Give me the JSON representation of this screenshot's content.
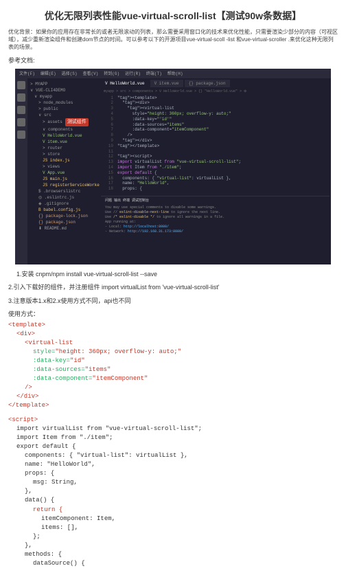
{
  "title": "优化无限列表性能vue-virtual-scroll-list【测试90w条数据】",
  "intro": "优化背景：如果你的应用存在非常长的或者无限滚动的列表，那么需要采用窗口化的技术来优化性能，只需要渲染少部分的内容（可视区域），减少重新渲染组件和创建dom节点的时间。可以参考以下的开源项目vue-virtual-scoll -list 和vue-virtual-scroller .来优化这种无限列表的场景。",
  "ref": "参考文档:",
  "menu": [
    "文件(F)",
    "编辑(E)",
    "选择(S)",
    "查看(V)",
    "转到(G)",
    "运行(R)",
    "终端(T)",
    "帮助(H)"
  ],
  "tabs": {
    "t1": "V HelloWorld.vue",
    "t2": "V item.vue",
    "t3": "{} package.json"
  },
  "crumb": "myapp > src > components > V HelloWorld.vue > {} \"HelloWorld.vue\" > ⊕",
  "tree": {
    "root": "> MYAPP",
    "folder": "∨ VUE-CLI4DEMO",
    "items": [
      {
        "t": "∨ myapp",
        "c": "",
        "i": 1
      },
      {
        "t": "> node_modules",
        "c": "",
        "i": 2
      },
      {
        "t": "> public",
        "c": "",
        "i": 2
      },
      {
        "t": "∨ src",
        "c": "",
        "i": 2
      },
      {
        "t": "> assets",
        "c": "",
        "i": 3
      },
      {
        "t": "∨ components",
        "c": "",
        "i": 3
      },
      {
        "t": "V HelloWorld.vue",
        "c": "green",
        "i": 3
      },
      {
        "t": "V item.vue",
        "c": "green",
        "i": 3
      },
      {
        "t": "> router",
        "c": "",
        "i": 3
      },
      {
        "t": "> store",
        "c": "",
        "i": 3
      },
      {
        "t": "JS index.js",
        "c": "yellow",
        "i": 3
      },
      {
        "t": "> views",
        "c": "",
        "i": 3
      },
      {
        "t": "V App.vue",
        "c": "green",
        "i": 3
      },
      {
        "t": "JS main.js",
        "c": "yellow",
        "i": 3
      },
      {
        "t": "JS registerServiceWorker.js",
        "c": "yellow",
        "i": 3
      },
      {
        "t": "$ .browserslistrc",
        "c": "",
        "i": 2
      },
      {
        "t": "◎ .eslintrc.js",
        "c": "",
        "i": 2
      },
      {
        "t": "◈ .gitignore",
        "c": "",
        "i": 2
      },
      {
        "t": "B babel.config.js",
        "c": "yellow",
        "i": 2
      },
      {
        "t": "{} package-lock.json",
        "c": "orange",
        "i": 2
      },
      {
        "t": "{} package.json",
        "c": "orange",
        "i": 2
      },
      {
        "t": "⬇ README.md",
        "c": "",
        "i": 2
      }
    ],
    "badge": "测试组件"
  },
  "code": [
    {
      "n": "1",
      "c": "<template>"
    },
    {
      "n": "2",
      "c": "  <div>"
    },
    {
      "n": "3",
      "c": "    <virtual-list"
    },
    {
      "n": "4",
      "c": "      style=\"height: 360px; overflow-y: auto;\""
    },
    {
      "n": "5",
      "c": "      :data-key=\"'id'\""
    },
    {
      "n": "6",
      "c": "      :data-sources=\"items\""
    },
    {
      "n": "7",
      "c": "      :data-component=\"itemComponent\""
    },
    {
      "n": "8",
      "c": "    />"
    },
    {
      "n": "9",
      "c": "  </div>"
    },
    {
      "n": "10",
      "c": "</template>"
    },
    {
      "n": "11",
      "c": ""
    },
    {
      "n": "12",
      "c": "<script>"
    },
    {
      "n": "13",
      "c": "import virtualList from \"vue-virtual-scroll-list\";"
    },
    {
      "n": "14",
      "c": "import Item from \"./item\";"
    },
    {
      "n": "15",
      "c": "export default {"
    },
    {
      "n": "16",
      "c": "  components: { \"virtual-list\": virtualList },"
    },
    {
      "n": "17",
      "c": "  name: \"HelloWorld\","
    },
    {
      "n": "18",
      "c": "  props: {"
    }
  ],
  "term_tabs": "问题  输出  终端  调试控制台",
  "term": [
    "You may use special comments to disable some warnings.",
    "Use // eslint-disable-next-line to ignore the next line.",
    "Use /* eslint-disable */ to ignore all warnings in a file.",
    "",
    "App running at:",
    "- Local:   http://localhost:8080/",
    "- Network: http://192.168.31.173:8080/"
  ],
  "steps": {
    "s1": "1.安装 cnpm/npm install vue-virtual-scroll-list --save",
    "s2": "2.引入下载好的组件，并注册组件 import virtualList from 'vue-virtual-scroll-list'",
    "s3": "3.注意版本1.x和2.x使用方式不同，api也不同",
    "s4": "使用方式："
  },
  "html_code": {
    "l1": "<template>",
    "l2": "<div>",
    "l3": "<virtual-list",
    "l4": "style=\"height: 360px; overflow-y: auto;\"",
    "l5": ":data-key=\"id\"",
    "l6": ":data-sources=\"items\"",
    "l7": ":data-component=\"itemComponent\"",
    "l8": "/>",
    "l9": "</div>",
    "l10": "</template>",
    "l11": "<script>",
    "l12": "import virtualList from \"vue-virtual-scroll-list\";",
    "l13": "import Item from \"./item\";",
    "l14": "export default {",
    "l15": "components: { \"virtual-list\": virtualList },",
    "l16": "name: \"HelloWorld\",",
    "l17": "props: {",
    "l18": "msg: String,",
    "l19": "},",
    "l20": "data() {",
    "l21": "return {",
    "l22": "itemComponent: Item,",
    "l23": "items: [],",
    "l24": "};",
    "l25": "},",
    "l26": "methods: {",
    "l27": "dataSource() {"
  }
}
